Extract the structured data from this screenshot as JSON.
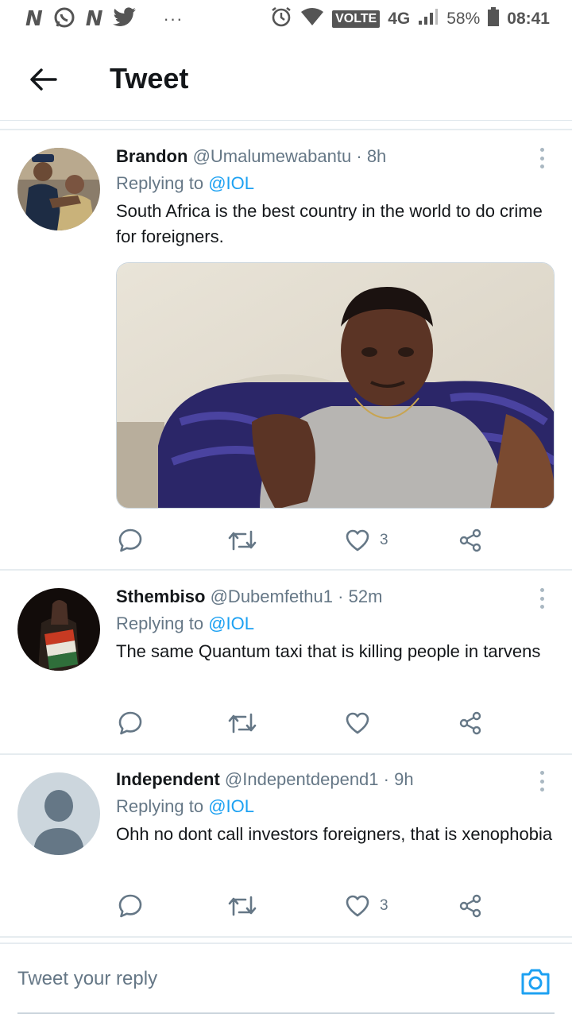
{
  "status_bar": {
    "left_letters": [
      "N",
      "N"
    ],
    "dots": "···",
    "network_label": "VOLTE",
    "network_type": "4G",
    "battery": "58%",
    "time": "08:41"
  },
  "header": {
    "title": "Tweet"
  },
  "tweets": [
    {
      "name": "Brandon",
      "handle": "@Umalumewabantu",
      "separator": "·",
      "time": "8h",
      "replying_prefix": "Replying to",
      "replying_to": "@IOL",
      "text": "South Africa is the best country in the world to do crime for foreigners.",
      "reply_count": "",
      "retweet_count": "",
      "like_count": "3"
    },
    {
      "name": "Sthembiso",
      "handle": "@Dubemfethu1",
      "separator": "·",
      "time": "52m",
      "replying_prefix": "Replying to",
      "replying_to": "@IOL",
      "text": "The same Quantum taxi that is killing people in tarvens",
      "reply_count": "",
      "retweet_count": "",
      "like_count": ""
    },
    {
      "name": "Independent",
      "handle": "@Indepentdepend1",
      "separator": "·",
      "time": "9h",
      "replying_prefix": "Replying to",
      "replying_to": "@IOL",
      "text": "Ohh no dont call investors foreigners, that is xenophobia",
      "reply_count": "",
      "retweet_count": "",
      "like_count": "3"
    }
  ],
  "reply_bar": {
    "placeholder": "Tweet your reply"
  },
  "colors": {
    "accent": "#1da1f2",
    "secondary_text": "#657786",
    "divider": "#e6ecf0"
  },
  "icons": [
    "back-arrow-icon",
    "more-vertical-icon",
    "reply-icon",
    "retweet-icon",
    "like-icon",
    "share-icon",
    "camera-icon"
  ]
}
